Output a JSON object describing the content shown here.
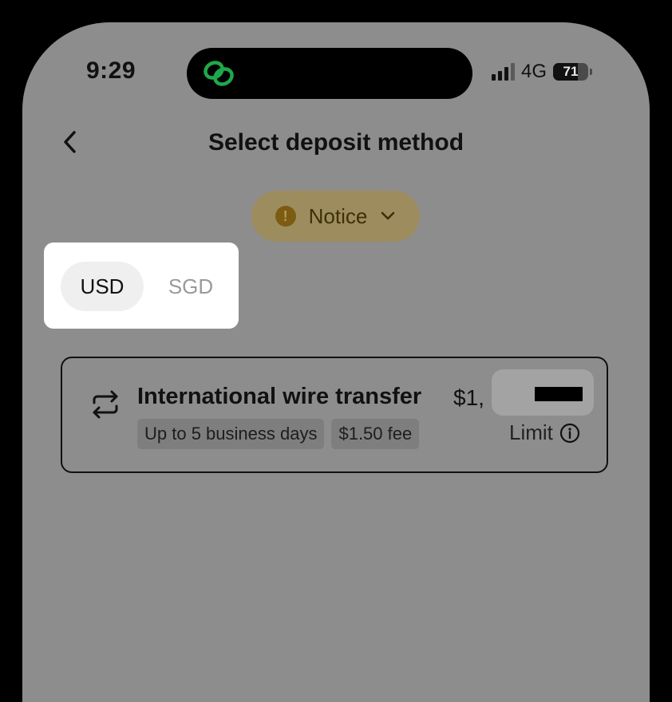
{
  "status_bar": {
    "time": "9:29",
    "network": "4G",
    "battery": "71",
    "battery_level_percent": 71,
    "signal_bars": 3
  },
  "header": {
    "title": "Select deposit method"
  },
  "notice": {
    "label": "Notice",
    "icon": "!"
  },
  "currency_toggle": {
    "options": [
      "USD",
      "SGD"
    ],
    "selected": "USD"
  },
  "methods": [
    {
      "title": "International wire transfer",
      "tags": [
        "Up to 5 business days",
        "$1.50 fee"
      ],
      "limit_amount": "$1,",
      "limit_label": "Limit"
    }
  ],
  "colors": {
    "background_dimmed": "#8d8d8d",
    "notice_pill": "#9d8c5d",
    "island_logo_green": "#1fa84a"
  }
}
